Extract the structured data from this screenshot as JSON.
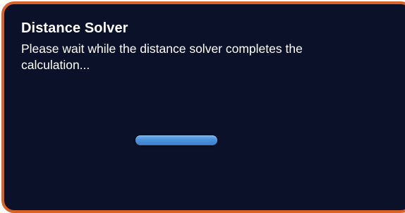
{
  "dialog": {
    "title": "Distance Solver",
    "message": "Please wait while the distance solver completes the calculation...",
    "progress": {
      "value": 1.0,
      "style": "indeterminate"
    }
  },
  "colors": {
    "background": "#0b1128",
    "border": "#d8622a",
    "text": "#ffffff",
    "progress": "#4b92dc"
  }
}
